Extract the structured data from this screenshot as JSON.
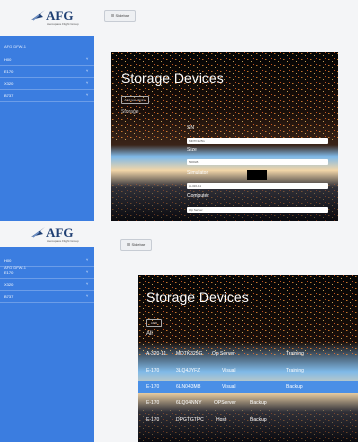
{
  "colors": {
    "sidebar": "#3b7de0",
    "row_highlight": "#4a8fe6",
    "brand": "#1f3f73"
  },
  "panel_top": {
    "logo": {
      "text": "AFG",
      "subtitle": "Aerospace Flight Group"
    },
    "sidebar": {
      "header": "AFG DFW-1",
      "items": [
        {
          "label": "H00",
          "caret": "˅"
        },
        {
          "label": "E170",
          "caret": "˅"
        },
        {
          "label": "X320",
          "caret": "˅"
        },
        {
          "label": "B737",
          "caret": "˅"
        }
      ]
    },
    "toolbar": {
      "button_label": "☰ Sidebar"
    },
    "viewer": {
      "title": "Storage Devices",
      "button_label": "Add new device",
      "subtitle": "Storage",
      "form": {
        "sn_label": "SN",
        "sn_value": "MDTK325G",
        "size_label": "Size",
        "size_value": "500GB",
        "simulator_label": "Simulator",
        "simulator_value": "A-320-11",
        "computer_label": "Computer",
        "computer_value": "Op Server"
      }
    }
  },
  "panel_bottom": {
    "logo": {
      "text": "AFG",
      "subtitle": "Aerospace Flight Group"
    },
    "sidebar": {
      "header": "AFG DFW-1",
      "items": [
        {
          "label": "H00",
          "caret": "˅"
        },
        {
          "label": "E170",
          "caret": "˅"
        },
        {
          "label": "X320",
          "caret": "˅"
        },
        {
          "label": "B737",
          "caret": "˅"
        }
      ]
    },
    "toolbar": {
      "button_label": "☰ Sidebar"
    },
    "viewer": {
      "title": "Storage Devices",
      "button_label": "ADD",
      "filter_label": "All",
      "rows": [
        {
          "sim": "A-320-11",
          "sn": "MDTK325G",
          "computer": "Op Server",
          "role": "Training",
          "highlight": false
        },
        {
          "sim": "E-170",
          "sn": "3LQ4JYFZ",
          "computer": "Visual",
          "role": "Training",
          "highlight": false
        },
        {
          "sim": "E-170",
          "sn": "6LN043M8",
          "computer": "Visual",
          "role": "Backup",
          "highlight": true
        },
        {
          "sim": "E-170",
          "sn": "6LQ04NNY",
          "computer": "OPServer",
          "role": "Backup",
          "highlight": false
        },
        {
          "sim": "E-170",
          "sn": "DPGTGTPC",
          "computer": "Host",
          "role": "Backup",
          "highlight": false
        }
      ]
    }
  }
}
